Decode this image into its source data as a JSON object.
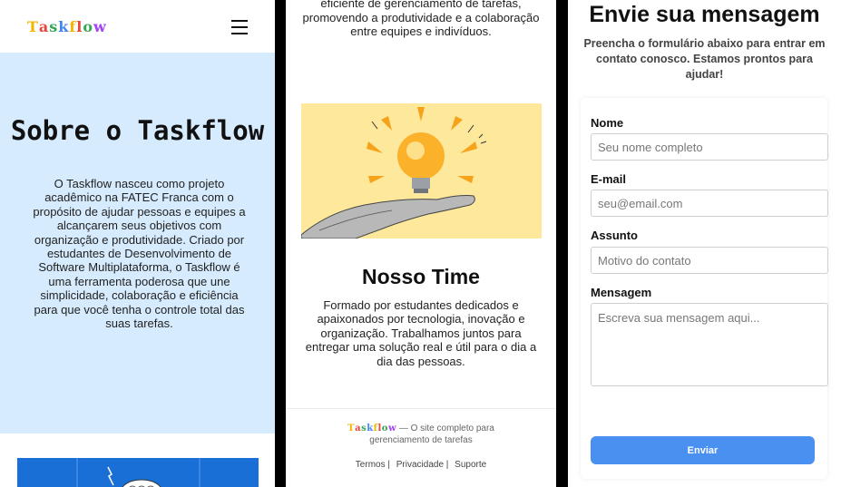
{
  "brand": {
    "name": "Taskflow",
    "letter_colors": [
      "#f4b400",
      "#e8453c",
      "#34a853",
      "#4285f4",
      "#f4b400",
      "#e8453c",
      "#34a853",
      "#a142f4"
    ]
  },
  "about": {
    "title": "Sobre o Taskflow",
    "body": "O Taskflow nasceu como projeto acadêmico na FATEC Franca com o propósito de ajudar pessoas e equipes a alcançarem seus objetivos com organização e produtividade. Criado por estudantes de Desenvolvimento de Software Multiplataforma, o Taskflow é uma ferramenta poderosa que une simplicidade, colaboração e eficiência para que você tenha o controle total das suas tarefas.",
    "bg_color": "#d6ebfd"
  },
  "mission": {
    "text_tail": "eficiente de gerenciamento de tarefas, promovendo a produtividade e a colaboração entre equipes e indivíduos."
  },
  "team": {
    "title": "Nosso Time",
    "body": "Formado por estudantes dedicados e apaixonados por tecnologia, inovação e organização. Trabalhamos juntos para entregar uma solução real e útil para o dia a dia das pessoas."
  },
  "footer": {
    "tagline_part1": "— O site completo para",
    "tagline_part2": "gerenciamento de tarefas",
    "links": [
      "Termos |",
      "Privacidade |",
      "Suporte"
    ]
  },
  "contact": {
    "title": "Envie sua mensagem",
    "subtitle": "Preencha o formulário abaixo para entrar em contato conosco. Estamos prontos para ajudar!",
    "fields": [
      {
        "label": "Nome",
        "placeholder": "Seu nome completo"
      },
      {
        "label": "E-mail",
        "placeholder": "seu@email.com"
      },
      {
        "label": "Assunto",
        "placeholder": "Motivo do contato"
      },
      {
        "label": "Mensagem",
        "placeholder": "Escreva sua mensagem aqui..."
      }
    ],
    "submit_label": "Enviar",
    "button_color": "#4a90f0"
  },
  "icons": {
    "menu": "hamburger-menu-icon"
  }
}
